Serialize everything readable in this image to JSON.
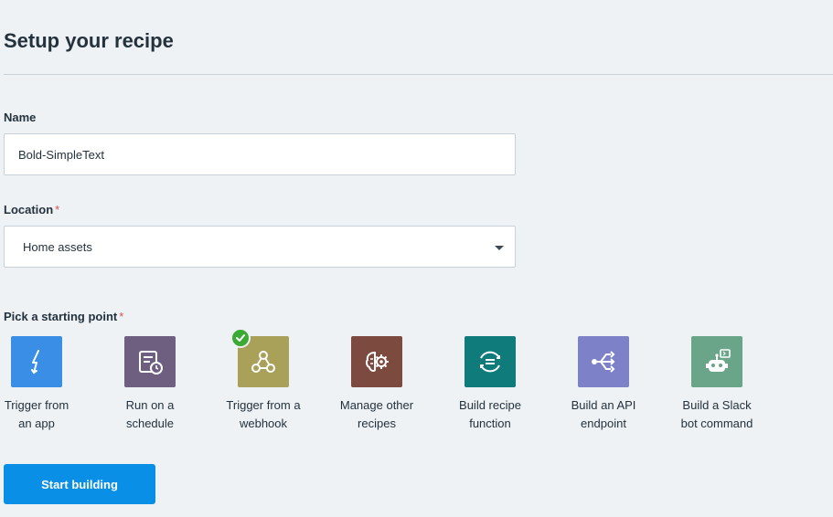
{
  "page": {
    "title": "Setup your recipe"
  },
  "form": {
    "name_label": "Name",
    "name_value": "Bold-SimpleText",
    "location_label": "Location",
    "location_required": "*",
    "location_value": "Home assets",
    "starting_point_label": "Pick a starting point",
    "starting_point_required": "*"
  },
  "starting_points": [
    {
      "label": "Trigger from\nan app",
      "icon": "lightning-icon",
      "color": "#3a8ee6",
      "selected": false
    },
    {
      "label": "Run on a\nschedule",
      "icon": "schedule-icon",
      "color": "#6e5f80",
      "selected": false
    },
    {
      "label": "Trigger from a\nwebhook",
      "icon": "webhook-icon",
      "color": "#a9a05a",
      "selected": true
    },
    {
      "label": "Manage other\nrecipes",
      "icon": "brain-gear-icon",
      "color": "#7d4a3f",
      "selected": false
    },
    {
      "label": "Build recipe\nfunction",
      "icon": "function-icon",
      "color": "#0f7b7b",
      "selected": false
    },
    {
      "label": "Build an API\nendpoint",
      "icon": "api-icon",
      "color": "#7d82c8",
      "selected": false
    },
    {
      "label": "Build a Slack\nbot command",
      "icon": "slack-bot-icon",
      "color": "#6aa58a",
      "selected": false
    }
  ],
  "actions": {
    "start_label": "Start building"
  },
  "colors": {
    "primary": "#0a8fe6",
    "background": "#eef2f5",
    "selected_check": "#3aaa35"
  }
}
